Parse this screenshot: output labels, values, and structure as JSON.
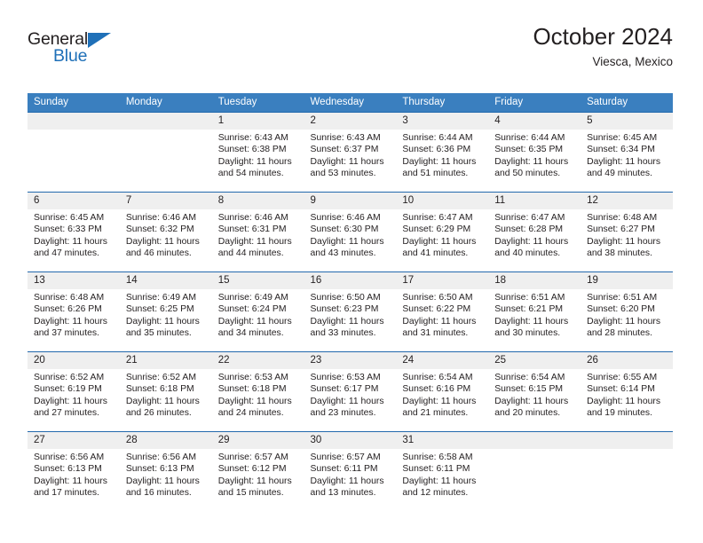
{
  "brand": {
    "name_part1": "General",
    "name_part2": "Blue",
    "triangle_icon": "triangle-icon",
    "accent_color": "#1f70b8"
  },
  "header": {
    "title": "October 2024",
    "location": "Viesca, Mexico"
  },
  "theme": {
    "header_bar_color": "#3a7fbf",
    "row_divider_color": "#2369ad",
    "daynum_band_color": "#efefef",
    "text_color": "#231f20"
  },
  "weekday_headers": [
    "Sunday",
    "Monday",
    "Tuesday",
    "Wednesday",
    "Thursday",
    "Friday",
    "Saturday"
  ],
  "weeks": [
    [
      {
        "day": "",
        "empty": true,
        "sunrise": "",
        "sunset": "",
        "daylight1": "",
        "daylight2": ""
      },
      {
        "day": "",
        "empty": true,
        "sunrise": "",
        "sunset": "",
        "daylight1": "",
        "daylight2": ""
      },
      {
        "day": "1",
        "empty": false,
        "sunrise": "Sunrise: 6:43 AM",
        "sunset": "Sunset: 6:38 PM",
        "daylight1": "Daylight: 11 hours",
        "daylight2": "and 54 minutes."
      },
      {
        "day": "2",
        "empty": false,
        "sunrise": "Sunrise: 6:43 AM",
        "sunset": "Sunset: 6:37 PM",
        "daylight1": "Daylight: 11 hours",
        "daylight2": "and 53 minutes."
      },
      {
        "day": "3",
        "empty": false,
        "sunrise": "Sunrise: 6:44 AM",
        "sunset": "Sunset: 6:36 PM",
        "daylight1": "Daylight: 11 hours",
        "daylight2": "and 51 minutes."
      },
      {
        "day": "4",
        "empty": false,
        "sunrise": "Sunrise: 6:44 AM",
        "sunset": "Sunset: 6:35 PM",
        "daylight1": "Daylight: 11 hours",
        "daylight2": "and 50 minutes."
      },
      {
        "day": "5",
        "empty": false,
        "sunrise": "Sunrise: 6:45 AM",
        "sunset": "Sunset: 6:34 PM",
        "daylight1": "Daylight: 11 hours",
        "daylight2": "and 49 minutes."
      }
    ],
    [
      {
        "day": "6",
        "empty": false,
        "sunrise": "Sunrise: 6:45 AM",
        "sunset": "Sunset: 6:33 PM",
        "daylight1": "Daylight: 11 hours",
        "daylight2": "and 47 minutes."
      },
      {
        "day": "7",
        "empty": false,
        "sunrise": "Sunrise: 6:46 AM",
        "sunset": "Sunset: 6:32 PM",
        "daylight1": "Daylight: 11 hours",
        "daylight2": "and 46 minutes."
      },
      {
        "day": "8",
        "empty": false,
        "sunrise": "Sunrise: 6:46 AM",
        "sunset": "Sunset: 6:31 PM",
        "daylight1": "Daylight: 11 hours",
        "daylight2": "and 44 minutes."
      },
      {
        "day": "9",
        "empty": false,
        "sunrise": "Sunrise: 6:46 AM",
        "sunset": "Sunset: 6:30 PM",
        "daylight1": "Daylight: 11 hours",
        "daylight2": "and 43 minutes."
      },
      {
        "day": "10",
        "empty": false,
        "sunrise": "Sunrise: 6:47 AM",
        "sunset": "Sunset: 6:29 PM",
        "daylight1": "Daylight: 11 hours",
        "daylight2": "and 41 minutes."
      },
      {
        "day": "11",
        "empty": false,
        "sunrise": "Sunrise: 6:47 AM",
        "sunset": "Sunset: 6:28 PM",
        "daylight1": "Daylight: 11 hours",
        "daylight2": "and 40 minutes."
      },
      {
        "day": "12",
        "empty": false,
        "sunrise": "Sunrise: 6:48 AM",
        "sunset": "Sunset: 6:27 PM",
        "daylight1": "Daylight: 11 hours",
        "daylight2": "and 38 minutes."
      }
    ],
    [
      {
        "day": "13",
        "empty": false,
        "sunrise": "Sunrise: 6:48 AM",
        "sunset": "Sunset: 6:26 PM",
        "daylight1": "Daylight: 11 hours",
        "daylight2": "and 37 minutes."
      },
      {
        "day": "14",
        "empty": false,
        "sunrise": "Sunrise: 6:49 AM",
        "sunset": "Sunset: 6:25 PM",
        "daylight1": "Daylight: 11 hours",
        "daylight2": "and 35 minutes."
      },
      {
        "day": "15",
        "empty": false,
        "sunrise": "Sunrise: 6:49 AM",
        "sunset": "Sunset: 6:24 PM",
        "daylight1": "Daylight: 11 hours",
        "daylight2": "and 34 minutes."
      },
      {
        "day": "16",
        "empty": false,
        "sunrise": "Sunrise: 6:50 AM",
        "sunset": "Sunset: 6:23 PM",
        "daylight1": "Daylight: 11 hours",
        "daylight2": "and 33 minutes."
      },
      {
        "day": "17",
        "empty": false,
        "sunrise": "Sunrise: 6:50 AM",
        "sunset": "Sunset: 6:22 PM",
        "daylight1": "Daylight: 11 hours",
        "daylight2": "and 31 minutes."
      },
      {
        "day": "18",
        "empty": false,
        "sunrise": "Sunrise: 6:51 AM",
        "sunset": "Sunset: 6:21 PM",
        "daylight1": "Daylight: 11 hours",
        "daylight2": "and 30 minutes."
      },
      {
        "day": "19",
        "empty": false,
        "sunrise": "Sunrise: 6:51 AM",
        "sunset": "Sunset: 6:20 PM",
        "daylight1": "Daylight: 11 hours",
        "daylight2": "and 28 minutes."
      }
    ],
    [
      {
        "day": "20",
        "empty": false,
        "sunrise": "Sunrise: 6:52 AM",
        "sunset": "Sunset: 6:19 PM",
        "daylight1": "Daylight: 11 hours",
        "daylight2": "and 27 minutes."
      },
      {
        "day": "21",
        "empty": false,
        "sunrise": "Sunrise: 6:52 AM",
        "sunset": "Sunset: 6:18 PM",
        "daylight1": "Daylight: 11 hours",
        "daylight2": "and 26 minutes."
      },
      {
        "day": "22",
        "empty": false,
        "sunrise": "Sunrise: 6:53 AM",
        "sunset": "Sunset: 6:18 PM",
        "daylight1": "Daylight: 11 hours",
        "daylight2": "and 24 minutes."
      },
      {
        "day": "23",
        "empty": false,
        "sunrise": "Sunrise: 6:53 AM",
        "sunset": "Sunset: 6:17 PM",
        "daylight1": "Daylight: 11 hours",
        "daylight2": "and 23 minutes."
      },
      {
        "day": "24",
        "empty": false,
        "sunrise": "Sunrise: 6:54 AM",
        "sunset": "Sunset: 6:16 PM",
        "daylight1": "Daylight: 11 hours",
        "daylight2": "and 21 minutes."
      },
      {
        "day": "25",
        "empty": false,
        "sunrise": "Sunrise: 6:54 AM",
        "sunset": "Sunset: 6:15 PM",
        "daylight1": "Daylight: 11 hours",
        "daylight2": "and 20 minutes."
      },
      {
        "day": "26",
        "empty": false,
        "sunrise": "Sunrise: 6:55 AM",
        "sunset": "Sunset: 6:14 PM",
        "daylight1": "Daylight: 11 hours",
        "daylight2": "and 19 minutes."
      }
    ],
    [
      {
        "day": "27",
        "empty": false,
        "sunrise": "Sunrise: 6:56 AM",
        "sunset": "Sunset: 6:13 PM",
        "daylight1": "Daylight: 11 hours",
        "daylight2": "and 17 minutes."
      },
      {
        "day": "28",
        "empty": false,
        "sunrise": "Sunrise: 6:56 AM",
        "sunset": "Sunset: 6:13 PM",
        "daylight1": "Daylight: 11 hours",
        "daylight2": "and 16 minutes."
      },
      {
        "day": "29",
        "empty": false,
        "sunrise": "Sunrise: 6:57 AM",
        "sunset": "Sunset: 6:12 PM",
        "daylight1": "Daylight: 11 hours",
        "daylight2": "and 15 minutes."
      },
      {
        "day": "30",
        "empty": false,
        "sunrise": "Sunrise: 6:57 AM",
        "sunset": "Sunset: 6:11 PM",
        "daylight1": "Daylight: 11 hours",
        "daylight2": "and 13 minutes."
      },
      {
        "day": "31",
        "empty": false,
        "sunrise": "Sunrise: 6:58 AM",
        "sunset": "Sunset: 6:11 PM",
        "daylight1": "Daylight: 11 hours",
        "daylight2": "and 12 minutes."
      },
      {
        "day": "",
        "empty": true,
        "sunrise": "",
        "sunset": "",
        "daylight1": "",
        "daylight2": ""
      },
      {
        "day": "",
        "empty": true,
        "sunrise": "",
        "sunset": "",
        "daylight1": "",
        "daylight2": ""
      }
    ]
  ]
}
